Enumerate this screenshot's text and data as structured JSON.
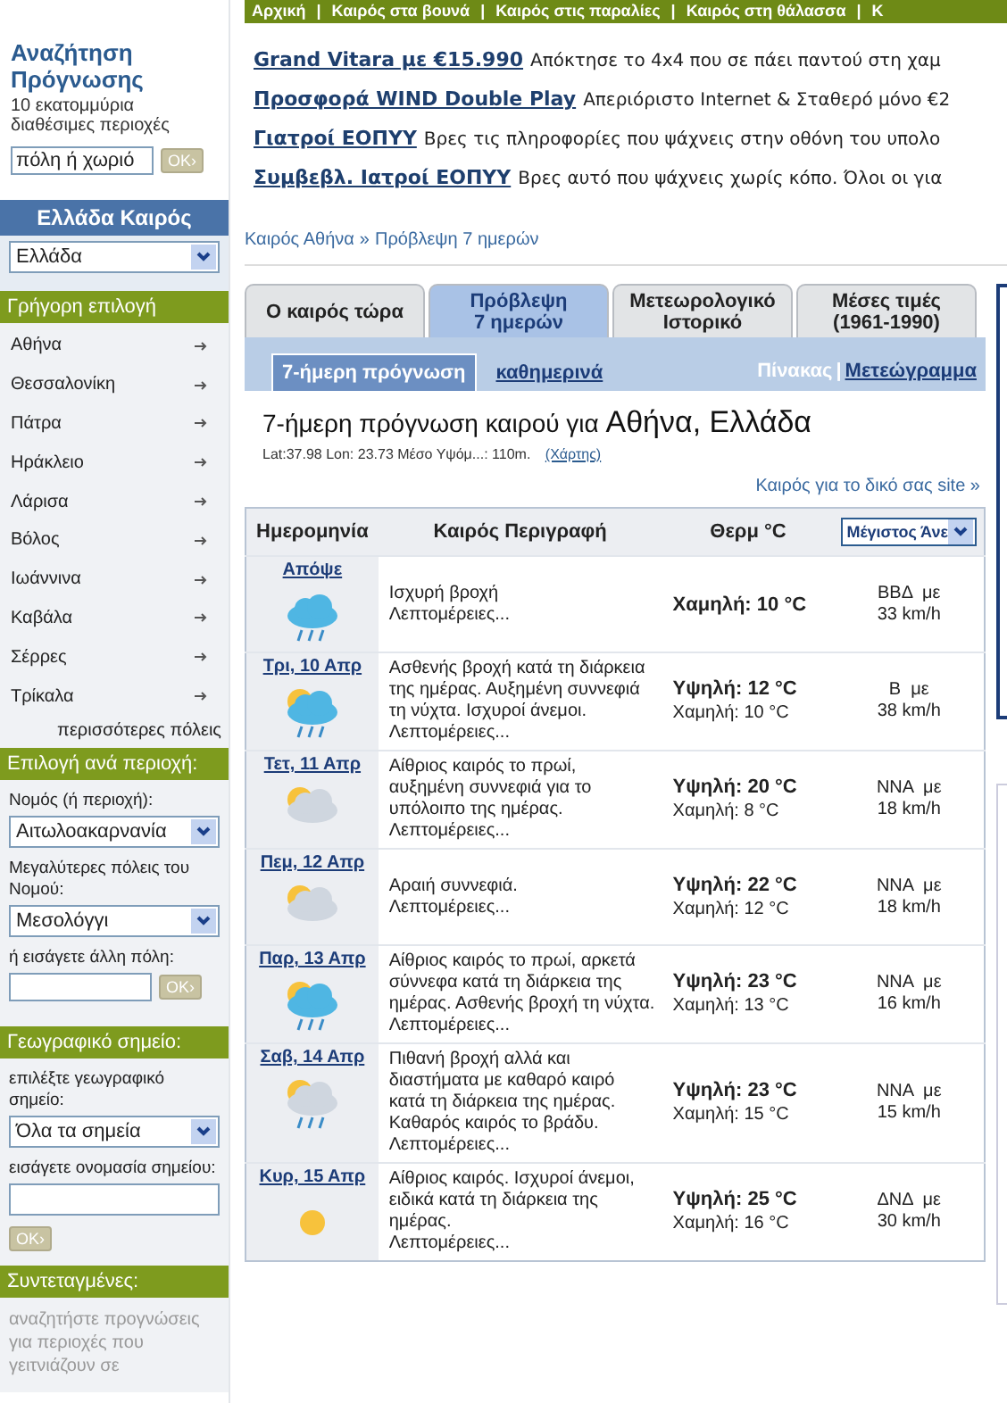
{
  "search": {
    "title": "Αναζήτηση Πρόγνωσης",
    "subtitle": "10 εκατομμύρια διαθέσιμες περιοχές",
    "placeholder": "πόλη ή χωριό",
    "button": "OK›"
  },
  "country": {
    "title": "Ελλάδα Καιρός",
    "value": "Ελλάδα"
  },
  "quick": {
    "title": "Γρήγορη επιλογή",
    "cities": [
      "Αθήνα",
      "Θεσσαλονίκη",
      "Πάτρα",
      "Ηράκλειο",
      "Λάρισα",
      "Βόλος",
      "Ιωάννινα",
      "Καβάλα",
      "Σέρρες",
      "Τρίκαλα"
    ],
    "more": "περισσότερες πόλεις"
  },
  "region": {
    "title": "Επιλογή ανά περιοχή:",
    "prefecture_label": "Νομός (ή περιοχή):",
    "prefecture": "Αιτωλοακαρνανία",
    "cities_label": "Μεγαλύτερες πόλεις του Νομού:",
    "city": "Μεσολόγγι",
    "other_label": "ή εισάγετε άλλη πόλη:",
    "button": "OK›"
  },
  "geo": {
    "title": "Γεωγραφικό σημείο:",
    "select_label": "επιλέξτε γεωγραφικό σημείο:",
    "select": "Όλα τα σημεία",
    "name_label": "εισάγετε ονομασία σημείου:",
    "button": "OK›"
  },
  "coordinates": {
    "title": "Συντεταγμένες:",
    "text": "αναζητήστε προγνώσεις για περιοχές που γειτνιάζουν σε"
  },
  "nav_links": [
    "Αρχική",
    "Καιρός στα βουνά",
    "Καιρός στις παραλίες",
    "Καιρός στη θάλασσα",
    "Κ"
  ],
  "nav_separator": "|",
  "ads": [
    {
      "link": "Grand Vitara με €15.990",
      "text": "Απόκτησε το 4x4 που σε πάει παντού στη χαμ"
    },
    {
      "link": "Προσφορά WIND Double Play",
      "text": "Απεριόριστο Internet & Σταθερό μόνο €2"
    },
    {
      "link": "Γιατροί ΕΟΠΥΥ",
      "text": "Βρες τις πληροφορίες που ψάχνεις στην οθόνη του υπολο"
    },
    {
      "link": "Συμβεβλ. Ιατροί ΕΟΠΥΥ",
      "text": "Βρες αυτό που ψάχνεις χωρίς κόπο. Όλοι οι για"
    }
  ],
  "breadcrumb": {
    "items": [
      "Καιρός Αθήνα",
      "Πρόβλεψη 7 ημερών"
    ],
    "separator": "»"
  },
  "tabs": [
    {
      "label": "Ο καιρός τώρα",
      "selected": false
    },
    {
      "label": "Πρόβλεψη\n7 ημερών",
      "selected": true
    },
    {
      "label": "Μετεωρολογικό\nΙστορικό",
      "selected": false
    },
    {
      "label": "Μέσες τιμές\n(1961-1990)",
      "selected": false
    }
  ],
  "subtabs": [
    {
      "label": "7-ήμερη πρόγνωση",
      "selected": true
    },
    {
      "label": "καθημερινά",
      "selected": false
    }
  ],
  "views": {
    "items": [
      {
        "label": "Πίνακας",
        "selected": true
      },
      {
        "label": "Μετεώγραμμα",
        "selected": false
      }
    ],
    "separator": "|"
  },
  "heading": {
    "prefix": "7-ήμερη πρόγνωση καιρού για",
    "place": "Αθήνα, Ελλάδα"
  },
  "location": {
    "info": "Lat:37.98 Lon: 23.73 Μέσο Υψόμ...: 110m.",
    "map_link": "(Χάρτης)"
  },
  "site_link": "Καιρός για το δικό σας site »",
  "table": {
    "columns": [
      "Ημερομηνία",
      "Καιρός Περιγραφή",
      "Θερμ °C"
    ],
    "wind_select": "Μέγιστος Άνε",
    "rows": [
      {
        "date": "Απόψε",
        "kind": "heavy-rain",
        "description": "Ισχυρή βροχή",
        "details": "Λεπτομέρειες...",
        "temps": [
          {
            "text": "Χαμηλή: 10 °C",
            "bold": true
          }
        ],
        "wind": [
          "ΒΒΔ  με",
          "33 km/h"
        ]
      },
      {
        "date": "Τρι, 10 Απρ",
        "kind": "light-rain",
        "description": "Ασθενής βροχή κατά τη διάρκεια της ημέρας. Αυξημένη συννεφιά τη νύχτα. Ισχυροί άνεμοι.",
        "details": "Λεπτομέρειες...",
        "temps": [
          {
            "text": "Υψηλή: 12 °C",
            "bold": true
          },
          {
            "text": "Χαμηλή: 10 °C",
            "bold": false
          }
        ],
        "wind": [
          "Β  με",
          "38 km/h"
        ]
      },
      {
        "date": "Τετ, 11 Απρ",
        "kind": "partly-cloudy",
        "description": "Αίθριος καιρός το πρωί, αυξημένη συννεφιά για το υπόλοιπο της ημέρας.",
        "details": "Λεπτομέρειες...",
        "temps": [
          {
            "text": "Υψηλή: 20 °C",
            "bold": true
          },
          {
            "text": "Χαμηλή: 8 °C",
            "bold": false
          }
        ],
        "wind": [
          "ΝΝΑ  με",
          "18 km/h"
        ]
      },
      {
        "date": "Πεμ, 12 Απρ",
        "kind": "few-clouds",
        "description": "Αραιή συννεφιά.",
        "details": "Λεπτομέρειες...",
        "temps": [
          {
            "text": "Υψηλή: 22 °C",
            "bold": true
          },
          {
            "text": "Χαμηλή: 12 °C",
            "bold": false
          }
        ],
        "wind": [
          "ΝΝΑ  με",
          "18 km/h"
        ]
      },
      {
        "date": "Παρ, 13 Απρ",
        "kind": "light-rain",
        "description": "Αίθριος καιρός το πρωί, αρκετά σύννεφα κατά τη διάρκεια της ημέρας. Ασθενής βροχή τη νύχτα.",
        "details": "Λεπτομέρειες...",
        "temps": [
          {
            "text": "Υψηλή: 23 °C",
            "bold": true
          },
          {
            "text": "Χαμηλή: 13 °C",
            "bold": false
          }
        ],
        "wind": [
          "ΝΝΑ  με",
          "16 km/h"
        ]
      },
      {
        "date": "Σαβ, 14 Απρ",
        "kind": "showers",
        "description": "Πιθανή βροχή αλλά και διαστήματα με καθαρό καιρό κατά τη διάρκεια της ημέρας. Καθαρός καιρός το βράδυ.",
        "details": "Λεπτομέρειες...",
        "temps": [
          {
            "text": "Υψηλή: 23 °C",
            "bold": true
          },
          {
            "text": "Χαμηλή: 15 °C",
            "bold": false
          }
        ],
        "wind": [
          "ΝΝΑ  με",
          "15 km/h"
        ]
      },
      {
        "date": "Κυρ, 15 Απρ",
        "kind": "sun",
        "description": "Αίθριος καιρός. Ισχυροί άνεμοι, ειδικά κατά τη διάρκεια της ημέρας.",
        "details": "Λεπτομέρειες...",
        "temps": [
          {
            "text": "Υψηλή: 25 °C",
            "bold": true
          },
          {
            "text": "Χαμηλή: 16 °C",
            "bold": false
          }
        ],
        "wind": [
          "ΔΝΔ  με",
          "30 km/h"
        ]
      }
    ]
  }
}
